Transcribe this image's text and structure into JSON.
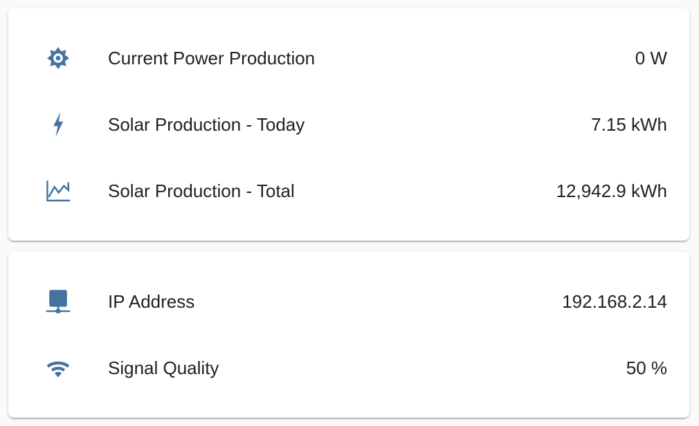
{
  "colors": {
    "icon": "#44739e",
    "text": "#212121",
    "card_background": "#ffffff",
    "page_background": "#fafafa"
  },
  "solar_card": {
    "rows": [
      {
        "icon": "white-balance-sunny-icon",
        "label": "Current Power Production",
        "value": "0 W"
      },
      {
        "icon": "flash-icon",
        "label": "Solar Production - Today",
        "value": "7.15 kWh"
      },
      {
        "icon": "chart-line-icon",
        "label": "Solar Production - Total",
        "value": "12,942.9 kWh"
      }
    ]
  },
  "network_card": {
    "rows": [
      {
        "icon": "network-icon",
        "label": "IP Address",
        "value": "192.168.2.14"
      },
      {
        "icon": "wifi-icon",
        "label": "Signal Quality",
        "value": "50 %"
      }
    ]
  }
}
